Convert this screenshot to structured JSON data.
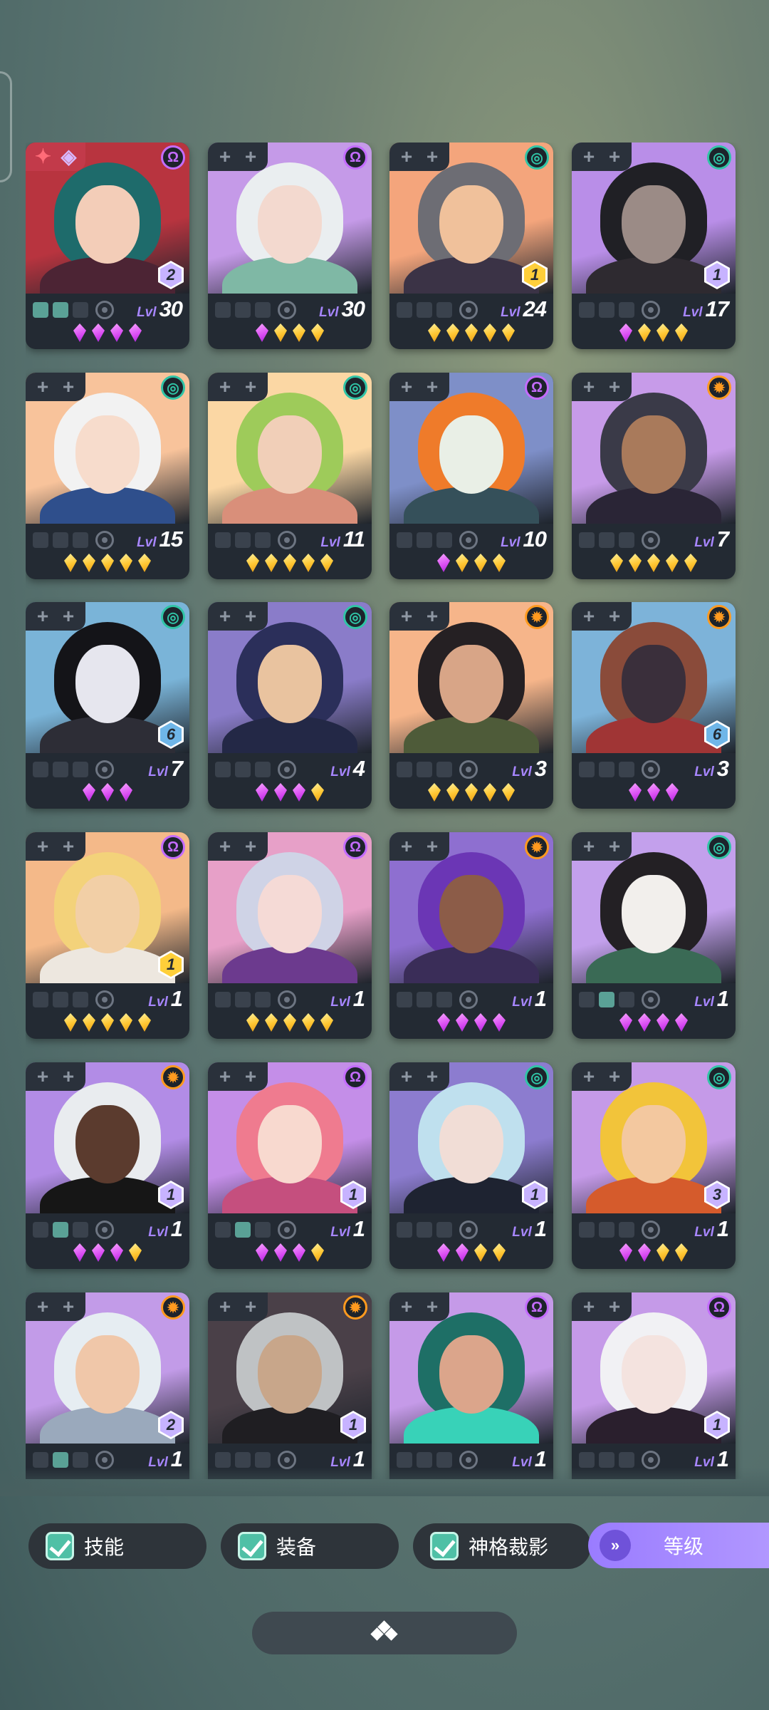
{
  "cards": [
    {
      "level": "30",
      "badge": "2",
      "cls": "omega",
      "gems": "pppp",
      "slots": [
        1,
        1,
        0
      ],
      "bg": "#b8343f",
      "hair": "#1e6b6b",
      "skin": "#f3cdb8",
      "body": "#4c2434",
      "cardAlt": true
    },
    {
      "level": "30",
      "badge": "",
      "cls": "omega",
      "gems": "pggg",
      "slots": [
        0,
        0,
        0
      ],
      "bg": "#c59ae8",
      "hair": "#eaeef0",
      "skin": "#f3d9cf",
      "body": "#7fb8a5"
    },
    {
      "level": "24",
      "badge": "1",
      "cls": "spiral",
      "gems": "ggggg",
      "slots": [
        0,
        0,
        0
      ],
      "bg": "#f4a57c",
      "hair": "#6d6d74",
      "skin": "#f0c19b",
      "body": "#3b3346",
      "badgeColor": "#ffcf3a"
    },
    {
      "level": "17",
      "badge": "1",
      "cls": "spiral",
      "gems": "pggg",
      "slots": [
        0,
        0,
        0
      ],
      "bg": "#b98ee8",
      "hair": "#202025",
      "skin": "#9b8b86",
      "body": "#2e2a30"
    },
    {
      "level": "15",
      "badge": "",
      "cls": "spiral",
      "gems": "ggggg",
      "slots": [
        0,
        0,
        0
      ],
      "bg": "#f8c39b",
      "hair": "#f2f2f2",
      "skin": "#f7dccc",
      "body": "#2f4f8c"
    },
    {
      "level": "11",
      "badge": "",
      "cls": "spiral",
      "gems": "ggggg",
      "slots": [
        0,
        0,
        0
      ],
      "bg": "#fbd7a4",
      "hair": "#9ecb5a",
      "skin": "#f1cfb8",
      "body": "#d98f7a"
    },
    {
      "level": "10",
      "badge": "",
      "cls": "omega",
      "gems": "pggg",
      "slots": [
        0,
        0,
        0
      ],
      "bg": "#7e8fc8",
      "hair": "#ef7b2a",
      "skin": "#e9efe6",
      "body": "#35505a"
    },
    {
      "level": "7",
      "badge": "",
      "cls": "sun",
      "gems": "ggggg",
      "slots": [
        0,
        0,
        0
      ],
      "bg": "#c79be9",
      "hair": "#3a3a48",
      "skin": "#a97a5b",
      "body": "#2a2536"
    },
    {
      "level": "7",
      "badge": "6",
      "cls": "spiral",
      "gems": "ppp",
      "slots": [
        0,
        0,
        0
      ],
      "bg": "#7ab4d8",
      "hair": "#141418",
      "skin": "#e6e6ee",
      "body": "#2d2d36",
      "badgeColor": "#6fb6e8"
    },
    {
      "level": "4",
      "badge": "",
      "cls": "spiral",
      "gems": "pppg",
      "slots": [
        0,
        0,
        0
      ],
      "bg": "#8a7cc9",
      "hair": "#2b2f5a",
      "skin": "#e9c39f",
      "body": "#232846"
    },
    {
      "level": "3",
      "badge": "",
      "cls": "sun",
      "gems": "ggggg",
      "slots": [
        0,
        0,
        0
      ],
      "bg": "#f6b58a",
      "hair": "#252023",
      "skin": "#d8a587",
      "body": "#4e5b39"
    },
    {
      "level": "3",
      "badge": "6",
      "cls": "sun",
      "gems": "ppp",
      "slots": [
        0,
        0,
        0
      ],
      "bg": "#7db3d9",
      "hair": "#8a4b3a",
      "skin": "#3a2f3b",
      "body": "#a03535",
      "badgeColor": "#6fb6e8"
    },
    {
      "level": "1",
      "badge": "1",
      "cls": "omega",
      "gems": "ggggg",
      "slots": [
        0,
        0,
        0
      ],
      "bg": "#f4b989",
      "hair": "#f3d27a",
      "skin": "#f2cfa6",
      "body": "#ede7df",
      "badgeColor": "#ffcf3a"
    },
    {
      "level": "1",
      "badge": "",
      "cls": "omega",
      "gems": "ggggg",
      "slots": [
        0,
        0,
        0
      ],
      "bg": "#e7a0c8",
      "hair": "#cfd3e6",
      "skin": "#f5dad6",
      "body": "#6c3a8e"
    },
    {
      "level": "1",
      "badge": "",
      "cls": "sun",
      "gems": "pppp",
      "slots": [
        0,
        0,
        0
      ],
      "bg": "#8e6fd0",
      "hair": "#6b36b5",
      "skin": "#8c5c48",
      "body": "#3a2d58"
    },
    {
      "level": "1",
      "badge": "",
      "cls": "spiral",
      "gems": "pppp",
      "slots": [
        0,
        1,
        0
      ],
      "bg": "#c3a0ec",
      "hair": "#232024",
      "skin": "#f2efec",
      "body": "#3a6a55"
    },
    {
      "level": "1",
      "badge": "1",
      "cls": "sun",
      "gems": "pppg",
      "slots": [
        0,
        1,
        0
      ],
      "bg": "#b28ce6",
      "hair": "#e9ecef",
      "skin": "#5b3b2e",
      "body": "#161616"
    },
    {
      "level": "1",
      "badge": "1",
      "cls": "omega",
      "gems": "pppg",
      "slots": [
        0,
        1,
        0
      ],
      "bg": "#c48ee8",
      "hair": "#ef7b8f",
      "skin": "#f8d9cf",
      "body": "#c54f7e"
    },
    {
      "level": "1",
      "badge": "1",
      "cls": "spiral",
      "gems": "ppgg",
      "slots": [
        0,
        0,
        0
      ],
      "bg": "#8c7ccf",
      "hair": "#bfe0ee",
      "skin": "#f1ddd6",
      "body": "#1e2331"
    },
    {
      "level": "1",
      "badge": "3",
      "cls": "spiral",
      "gems": "ppgg",
      "slots": [
        0,
        0,
        0
      ],
      "bg": "#c59ae8",
      "hair": "#f2c43a",
      "skin": "#f3c89f",
      "body": "#d55b2c"
    },
    {
      "level": "1",
      "badge": "2",
      "cls": "sun",
      "gems": "",
      "slots": [
        0,
        1,
        0
      ],
      "bg": "#c29be8",
      "hair": "#e6edf2",
      "skin": "#f0c7a9",
      "body": "#9aa9bc"
    },
    {
      "level": "1",
      "badge": "1",
      "cls": "sun",
      "gems": "",
      "slots": [
        0,
        0,
        0
      ],
      "bg": "#4a4048",
      "hair": "#bfc2c4",
      "skin": "#c8a68a",
      "body": "#1f1e22"
    },
    {
      "level": "1",
      "badge": "",
      "cls": "omega",
      "gems": "",
      "slots": [
        0,
        0,
        0
      ],
      "bg": "#c59ae8",
      "hair": "#1e6f66",
      "skin": "#dba58b",
      "body": "#38d2b8"
    },
    {
      "level": "1",
      "badge": "1",
      "cls": "omega",
      "gems": "",
      "slots": [
        0,
        0,
        0
      ],
      "bg": "#c59ae8",
      "hair": "#f1f1f4",
      "skin": "#f4e3df",
      "body": "#2a1f2d"
    }
  ],
  "labels": {
    "lvl": "Lvl",
    "skills": "技能",
    "equipment": "装备",
    "divine_shadow": "神格裁影",
    "sort_level": "等级"
  },
  "colors": {
    "gem_purple": "#d94bf3",
    "gem_gold": "#ffc733",
    "filter_check": "#4fc0a6",
    "sort_accent": "#9a7cff",
    "omega": "#c46cff",
    "spiral": "#30c4a6",
    "sun": "#ff9a1f"
  }
}
